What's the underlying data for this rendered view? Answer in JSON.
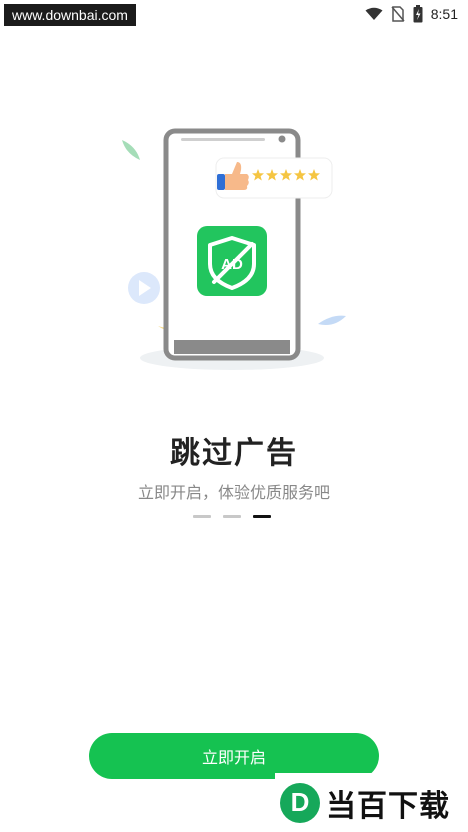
{
  "status_bar": {
    "watermark_url": "www.downbai.com",
    "time": "8:51",
    "icons": [
      "wifi-icon",
      "no-sim-icon",
      "battery-icon"
    ]
  },
  "illustration": {
    "badge_text": "AD",
    "rating_stars": 5
  },
  "onboarding": {
    "title": "跳过广告",
    "subtitle": "立即开启，体验优质服务吧",
    "page_count": 3,
    "active_page": 3
  },
  "actions": {
    "start_label": "立即开启"
  },
  "site_logo": {
    "letter": "D",
    "text": "当百下载"
  },
  "colors": {
    "accent_green": "#15c251",
    "badge_green": "#22c55e",
    "phone_frame": "#8a8a8a",
    "star_yellow": "#f5c542",
    "thumb_skin": "#f7b98a",
    "cuff_blue": "#2f6fd6"
  }
}
